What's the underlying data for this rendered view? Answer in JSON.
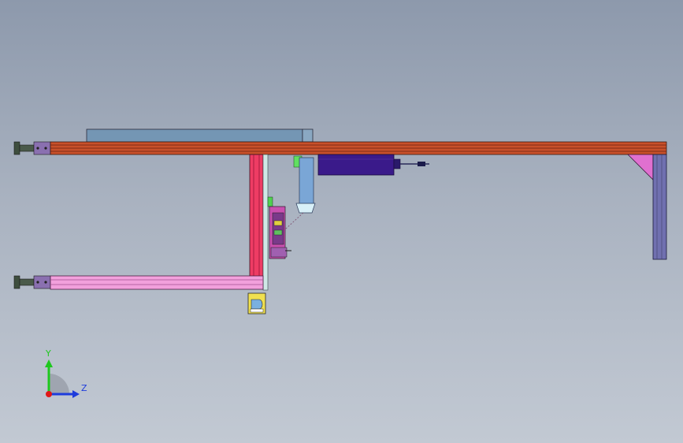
{
  "triad": {
    "y_label": "Y",
    "z_label": "Z",
    "colors": {
      "y": "#1ec81e",
      "z": "#1e3cdc",
      "x": "#e01818"
    }
  },
  "colors": {
    "background_top": "#8d99ac",
    "background_bottom": "#c2c9d3",
    "beam": "#c8502a",
    "leg": "#ee3c64",
    "lower_rail": "#f2a0dc",
    "top_plate": "#7496b4",
    "motor": "#3a1a8a",
    "side_post": "#7070b0",
    "gusset": "#e070d0",
    "foot": "#4a5a4a",
    "end_block": "#8a70b0"
  },
  "parts": [
    "leveling-foot-upper",
    "leveling-foot-lower",
    "main-beam",
    "top-plate",
    "vertical-leg",
    "lower-rail",
    "motor",
    "cable",
    "cylinder-arm",
    "gripper-assembly",
    "bottom-block",
    "side-post",
    "gusset-bracket"
  ]
}
